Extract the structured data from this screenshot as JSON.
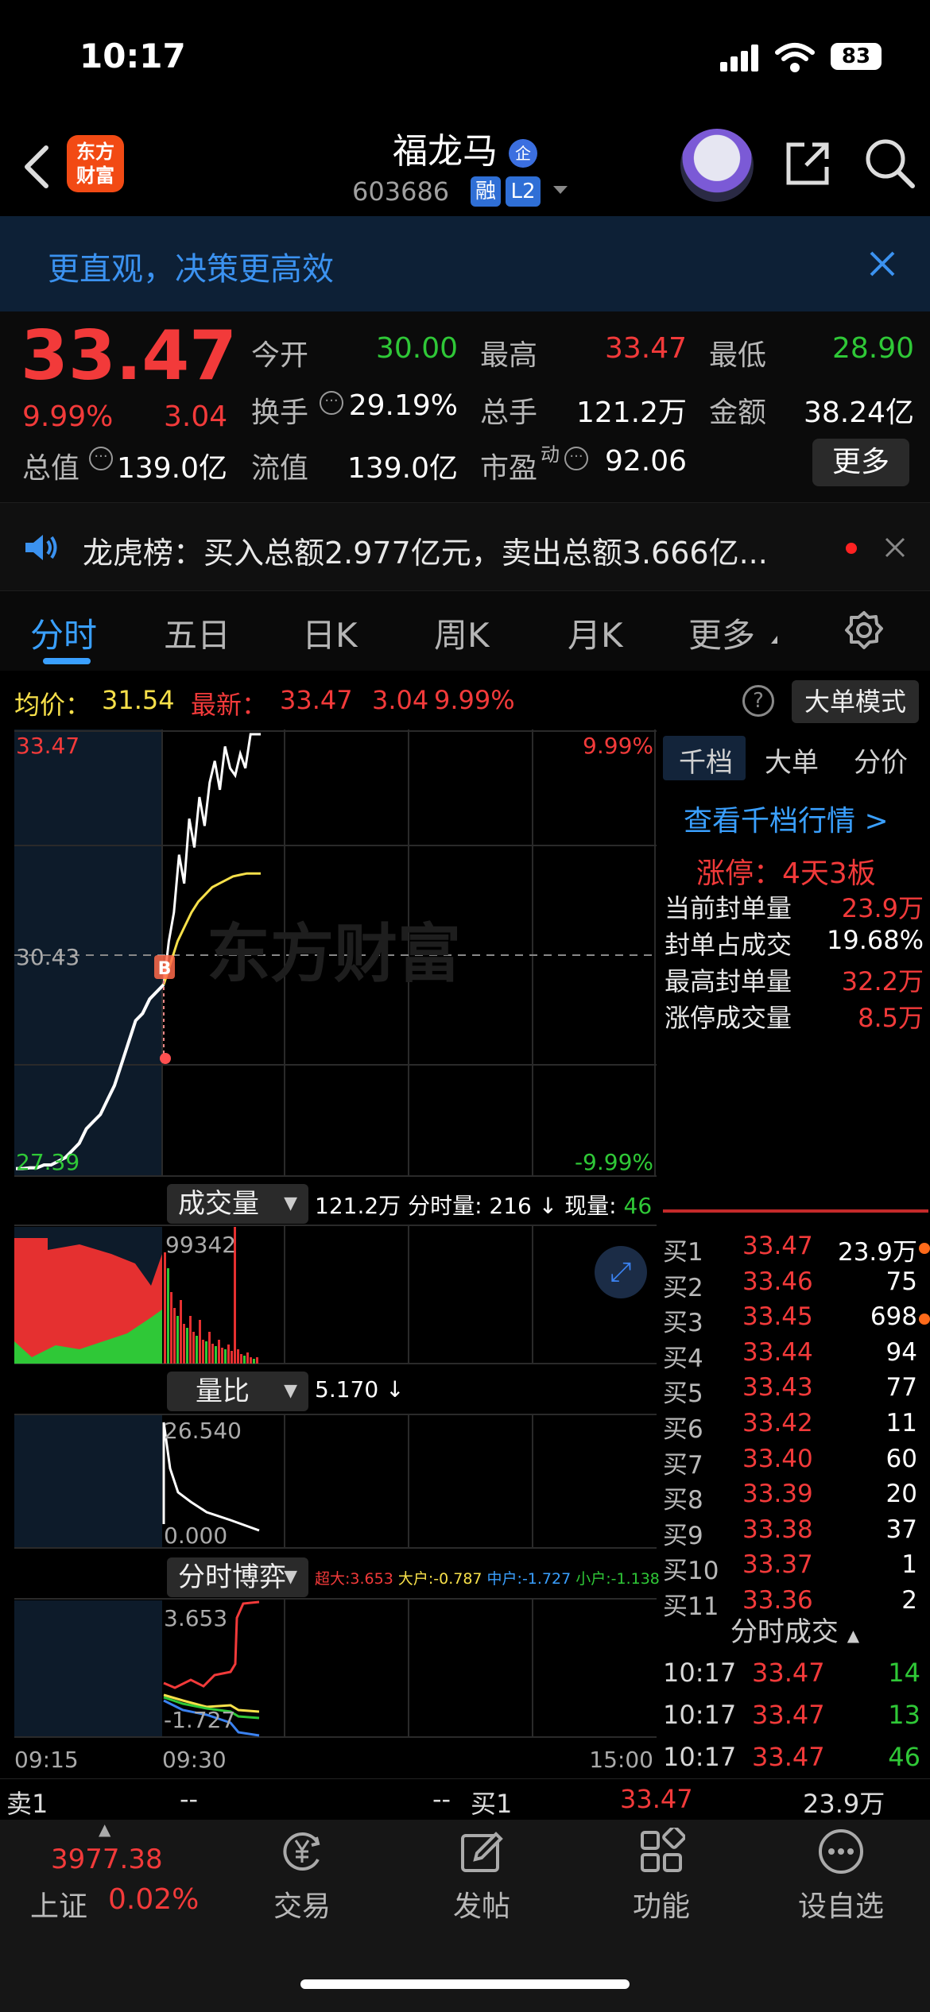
{
  "status_bar": {
    "time": "10:17",
    "battery": "83"
  },
  "header": {
    "title": "福龙马",
    "title_badge": "企",
    "code": "603686",
    "tag_margin": "融",
    "tag_level": "L2",
    "logo_text_top": "东方",
    "logo_text_bottom": "财富"
  },
  "banner": {
    "text": "更直观，决策更高效"
  },
  "quote": {
    "last": "33.47",
    "pct": "9.99%",
    "change": "3.04",
    "open_label": "今开",
    "open": "30.00",
    "high_label": "最高",
    "high": "33.47",
    "low_label": "最低",
    "low": "28.90",
    "turnover_label": "换手",
    "turnover": "29.19%",
    "volume_label": "总手",
    "volume": "121.2万",
    "amount_label": "金额",
    "amount": "38.24亿",
    "mktcap_label": "总值",
    "mktcap": "139.0亿",
    "float_label": "流值",
    "float_cap": "139.0亿",
    "pe_label": "市盈",
    "pe_sup": "动",
    "pe": "92.06",
    "more": "更多"
  },
  "notice": {
    "text": "龙虎榜：买入总额2.977亿元，卖出总额3.666亿..."
  },
  "tabs": [
    "分时",
    "五日",
    "日K",
    "周K",
    "月K",
    "更多"
  ],
  "info_row": {
    "avg_label": "均价：",
    "avg": "31.54",
    "latest_label": "最新：",
    "latest": "33.47",
    "latest_change": "3.04",
    "latest_pct": "9.99%",
    "big_order_mode": "大单模式"
  },
  "chart_data": {
    "type": "line",
    "x_ticks": [
      "09:15",
      "09:30",
      "15:00"
    ],
    "y_max_label": "33.47",
    "y_mid_label": "30.43",
    "y_min_label": "27.39",
    "pct_max_label": "9.99%",
    "pct_min_label": "-9.99%",
    "ylim": [
      27.39,
      33.47
    ],
    "prev_close": 30.43,
    "price_series_pre": [
      27.45,
      27.45,
      27.46,
      27.46,
      27.5,
      27.5,
      27.55,
      27.6,
      27.7,
      27.8,
      28.0,
      28.1,
      28.2,
      28.4,
      28.6,
      28.9,
      29.2,
      29.5,
      29.6,
      29.8,
      29.9,
      30.0
    ],
    "price_series": [
      30.0,
      30.6,
      31.0,
      31.8,
      31.4,
      32.3,
      31.9,
      32.6,
      32.2,
      32.8,
      33.1,
      32.7,
      33.3,
      33.0,
      32.9,
      33.2,
      33.0,
      33.47,
      33.47,
      33.47
    ],
    "avg_series": [
      30.0,
      30.3,
      30.6,
      30.8,
      31.0,
      31.15,
      31.25,
      31.35,
      31.4,
      31.45,
      31.5,
      31.52,
      31.54,
      31.54,
      31.54
    ],
    "watermark": "东方财富",
    "marker": "B"
  },
  "volume_panel": {
    "label": "成交量",
    "total": "121.2万",
    "tick_vol_label": "分时量:",
    "tick_vol": "216",
    "now_vol_label": "现量:",
    "now_vol": "46",
    "max_label": "99342"
  },
  "ratio_panel": {
    "label": "量比",
    "value": "5.170",
    "max_label": "26.540",
    "min_label": "0.000"
  },
  "game_panel": {
    "label": "分时博弈",
    "super": "超大:3.653",
    "large": "大户:-0.787",
    "mid": "中户:-1.727",
    "small": "小户:-1.138",
    "max_label": "3.653",
    "min_label": "-1.727"
  },
  "right_panel": {
    "tabs": [
      "千档",
      "大单",
      "分价"
    ],
    "view_link": "查看千档行情 >",
    "limit_up": "涨停：4天3板",
    "stats": [
      {
        "label": "当前封单量",
        "value": "23.9万"
      },
      {
        "label": "封单占成交",
        "value": "19.68%"
      },
      {
        "label": "最高封单量",
        "value": "32.2万"
      },
      {
        "label": "涨停成交量",
        "value": "8.5万"
      }
    ],
    "bids": [
      {
        "label": "买1",
        "price": "33.47",
        "vol": "23.9万",
        "dot": true
      },
      {
        "label": "买2",
        "price": "33.46",
        "vol": "75",
        "dot": false
      },
      {
        "label": "买3",
        "price": "33.45",
        "vol": "698",
        "dot": true
      },
      {
        "label": "买4",
        "price": "33.44",
        "vol": "94",
        "dot": false
      },
      {
        "label": "买5",
        "price": "33.43",
        "vol": "77",
        "dot": false
      },
      {
        "label": "买6",
        "price": "33.42",
        "vol": "11",
        "dot": false
      },
      {
        "label": "买7",
        "price": "33.40",
        "vol": "60",
        "dot": false
      },
      {
        "label": "买8",
        "price": "33.39",
        "vol": "20",
        "dot": false
      },
      {
        "label": "买9",
        "price": "33.38",
        "vol": "37",
        "dot": false
      },
      {
        "label": "买10",
        "price": "33.37",
        "vol": "1",
        "dot": false
      },
      {
        "label": "买11",
        "price": "33.36",
        "vol": "2",
        "dot": false
      }
    ],
    "trades_title": "分时成交",
    "trades": [
      {
        "time": "10:17",
        "price": "33.47",
        "vol": "14"
      },
      {
        "time": "10:17",
        "price": "33.47",
        "vol": "13"
      },
      {
        "time": "10:17",
        "price": "33.47",
        "vol": "46"
      }
    ]
  },
  "book_row": {
    "sell1_label": "卖1",
    "sell1_price": "--",
    "sell1_vol": "--",
    "buy1_label": "买1",
    "buy1_price": "33.47",
    "buy1_vol": "23.9万"
  },
  "bottom_nav": {
    "index_value": "3977.38",
    "index_name": "上证",
    "index_pct": "0.02%",
    "items": [
      "交易",
      "发帖",
      "功能",
      "设自选"
    ]
  }
}
